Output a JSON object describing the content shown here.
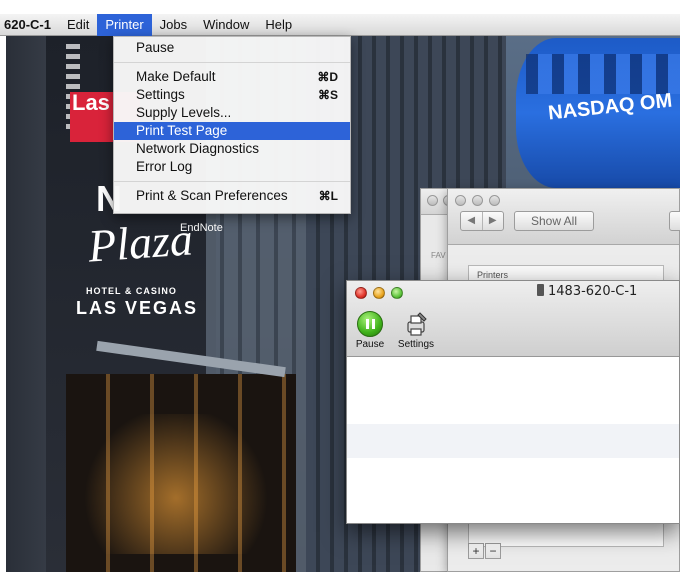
{
  "menubar": {
    "app_name": "620-C-1",
    "items": [
      "Edit",
      "Printer",
      "Jobs",
      "Window",
      "Help"
    ]
  },
  "printer_menu": {
    "items": [
      {
        "label": "Pause",
        "shortcut": ""
      },
      {
        "label": "Make Default",
        "shortcut": "⌘D"
      },
      {
        "label": "Settings",
        "shortcut": "⌘S"
      },
      {
        "label": "Supply Levels...",
        "shortcut": ""
      },
      {
        "label": "Print Test Page",
        "shortcut": "",
        "highlighted": true
      },
      {
        "label": "Network Diagnostics",
        "shortcut": ""
      },
      {
        "label": "Error Log",
        "shortcut": ""
      },
      {
        "label": "Print & Scan Preferences",
        "shortcut": "⌘L"
      }
    ]
  },
  "prefs_window": {
    "show_all": "Show All",
    "nav_back": "◀",
    "nav_forward": "▶",
    "list_header": "Printers",
    "add": "+",
    "remove": "−"
  },
  "back_window": {
    "sidebar_label": "FAV"
  },
  "queue_window": {
    "title": "1483-620-C-1",
    "pause_label": "Pause",
    "settings_label": "Settings"
  },
  "wallpaper": {
    "nasdaq": "NASDAQ OM",
    "las": "Las",
    "new": "N",
    "plaza": "Plaza",
    "hotel": "HOTEL & CASINO",
    "las_vegas": "LAS VEGAS",
    "endnote": "EndNote"
  },
  "colors": {
    "menu_highlight": "#2d63d8",
    "close": "#e0342a",
    "minimize": "#e9a520",
    "zoom": "#5ec43c"
  }
}
